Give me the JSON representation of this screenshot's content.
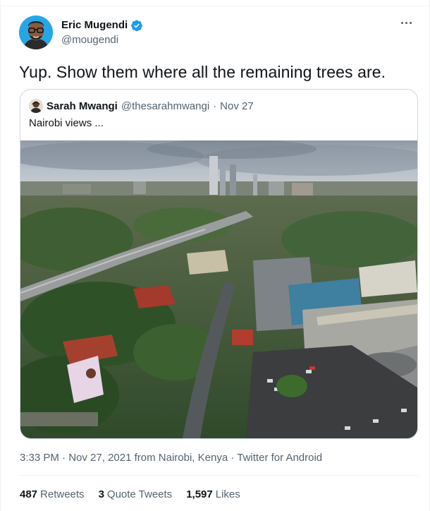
{
  "author": {
    "name": "Eric Mugendi",
    "handle": "@mougendi",
    "verified": true,
    "accent_color": "#1d9bf0"
  },
  "tweet": {
    "text": "Yup. Show them where all the remaining trees are."
  },
  "quoted_tweet": {
    "author_name": "Sarah Mwangi",
    "author_handle": "@thesarahmwangi",
    "separator": "·",
    "date": "Nov 27",
    "text": "Nairobi views ...",
    "image_alt": "Aerial view of Nairobi with highway, skyscrapers and trees"
  },
  "meta": {
    "time": "3:33 PM",
    "separator": "·",
    "date": "Nov 27, 2021",
    "location": "from Nairobi, Kenya",
    "client": "Twitter for Android"
  },
  "stats": {
    "retweets_count": "487",
    "retweets_label": "Retweets",
    "quotes_count": "3",
    "quotes_label": "Quote Tweets",
    "likes_count": "1,597",
    "likes_label": "Likes"
  },
  "icons": {
    "verified": "verified-badge-icon",
    "more": "more-horizontal-icon"
  }
}
